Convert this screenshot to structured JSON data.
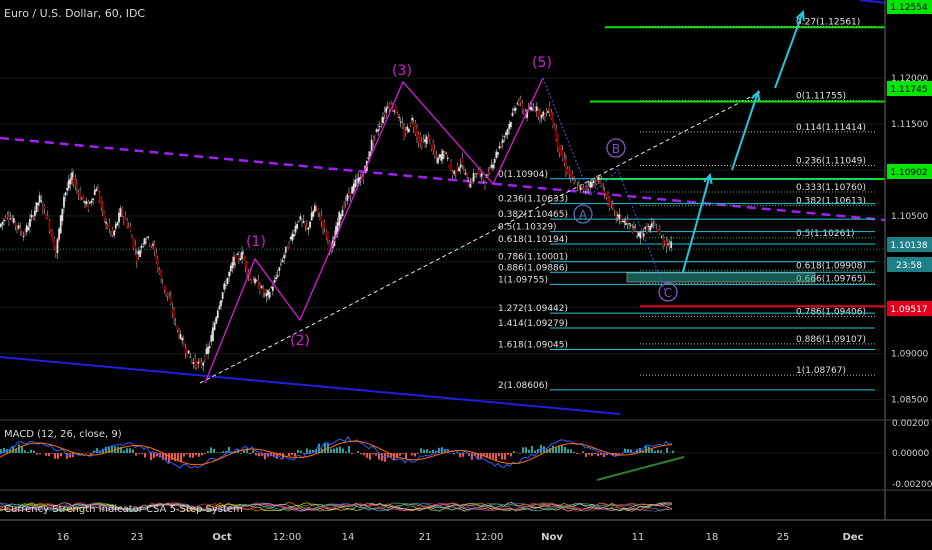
{
  "header": {
    "title": "Euro / U.S. Dollar, 60, IDC"
  },
  "chart_data": {
    "type": "line",
    "title": "Euro / U.S. Dollar, 60, IDC",
    "price_axis": {
      "ticks": [
        "1.12000",
        "1.11500",
        "1.11000",
        "1.10500",
        "1.10000",
        "1.09500",
        "1.09000",
        "1.08500"
      ],
      "ylim": [
        1.083,
        1.1285
      ]
    },
    "time_axis": {
      "ticks": [
        "16",
        "23",
        "Oct",
        "12:00",
        "14",
        "21",
        "12:00",
        "Nov",
        "11",
        "18",
        "25",
        "Dec"
      ]
    },
    "wave_labels": [
      "(1)",
      "(2)",
      "(3)",
      "(5)",
      "A",
      "B",
      "C"
    ],
    "price_badges": [
      {
        "value": "1.12554",
        "color": "#00e600"
      },
      {
        "value": "1.11745",
        "color": "#00e600"
      },
      {
        "value": "1.10902",
        "color": "#00e600"
      },
      {
        "value": "1.10138",
        "color": "#1e7f86"
      },
      {
        "value": "23:58",
        "color": "#1e7f86"
      },
      {
        "value": "1.09517",
        "color": "#e0001b"
      }
    ],
    "horizontal_levels": [
      {
        "price": 1.12554,
        "color": "#00e600"
      },
      {
        "price": 1.11745,
        "color": "#00e600"
      },
      {
        "price": 1.10902,
        "color": "#00e600"
      },
      {
        "price": 1.09517,
        "color": "#e0001b"
      }
    ],
    "fib_upper": [
      {
        "label": "0.27(1.12561)",
        "price": 1.12561
      },
      {
        "label": "0(1.11755)",
        "price": 1.11755
      },
      {
        "label": "0.114(1.11414)",
        "price": 1.11414
      },
      {
        "label": "0.236(1.11049)",
        "price": 1.11049
      },
      {
        "label": "0.333(1.10760)",
        "price": 1.1076
      },
      {
        "label": "0.382(1.10613)",
        "price": 1.10613
      },
      {
        "label": "0.5(1.10261)",
        "price": 1.10261
      },
      {
        "label": "0.618(1.09908)",
        "price": 1.09908
      },
      {
        "label": "0.666(1.09765)",
        "price": 1.09765
      },
      {
        "label": "0.786(1.09406)",
        "price": 1.09406
      },
      {
        "label": "0.886(1.09107)",
        "price": 1.09107
      },
      {
        "label": "1(1.08767)",
        "price": 1.08767
      }
    ],
    "fib_lower": [
      {
        "label": "0(1.10904)",
        "price": 1.10904
      },
      {
        "label": "0.236(1.10633)",
        "price": 1.10633
      },
      {
        "label": "0.382(1.10465)",
        "price": 1.10465
      },
      {
        "label": "0.5(1.10329)",
        "price": 1.10329
      },
      {
        "label": "0.618(1.10194)",
        "price": 1.10194
      },
      {
        "label": "0.786(1.10001)",
        "price": 1.10001
      },
      {
        "label": "0.886(1.09886)",
        "price": 1.09886
      },
      {
        "label": "1(1.09755)",
        "price": 1.09755
      },
      {
        "label": "1.272(1.09442)",
        "price": 1.09442
      },
      {
        "label": "1.414(1.09279)",
        "price": 1.09279
      },
      {
        "label": "1.618(1.09045)",
        "price": 1.09045
      },
      {
        "label": "2(1.08606)",
        "price": 1.08606
      }
    ],
    "price_path": [
      1.1038,
      1.1052,
      1.1041,
      1.1029,
      1.1048,
      1.1069,
      1.1045,
      1.101,
      1.1072,
      1.1093,
      1.1071,
      1.106,
      1.1082,
      1.1045,
      1.1028,
      1.1055,
      1.1038,
      1.1005,
      1.1028,
      1.1017,
      1.098,
      1.0958,
      1.0925,
      1.0905,
      1.089,
      1.0888,
      1.091,
      1.095,
      1.0978,
      1.1002,
      1.1008,
      1.0982,
      1.0975,
      1.0962,
      1.0978,
      1.1004,
      1.1025,
      1.1048,
      1.1035,
      1.106,
      1.104,
      1.1012,
      1.105,
      1.107,
      1.1086,
      1.1095,
      1.113,
      1.115,
      1.1172,
      1.1165,
      1.1138,
      1.1155,
      1.1128,
      1.1135,
      1.111,
      1.112,
      1.1095,
      1.1108,
      1.1085,
      1.1098,
      1.1088,
      1.111,
      1.113,
      1.115,
      1.1176,
      1.116,
      1.117,
      1.1158,
      1.1166,
      1.1128,
      1.1102,
      1.1085,
      1.1078,
      1.1085,
      1.109,
      1.107,
      1.1052,
      1.1045,
      1.1038,
      1.1028,
      1.1036,
      1.104,
      1.1022,
      1.1018
    ],
    "indicators": [
      {
        "name": "MACD (12, 26, close, 9)",
        "ticks": [
          "0.00200",
          "0.00000",
          "-0.00200"
        ]
      },
      {
        "name": "Currency Strength Indicator CSA 5-Step System",
        "ticks": []
      }
    ]
  }
}
